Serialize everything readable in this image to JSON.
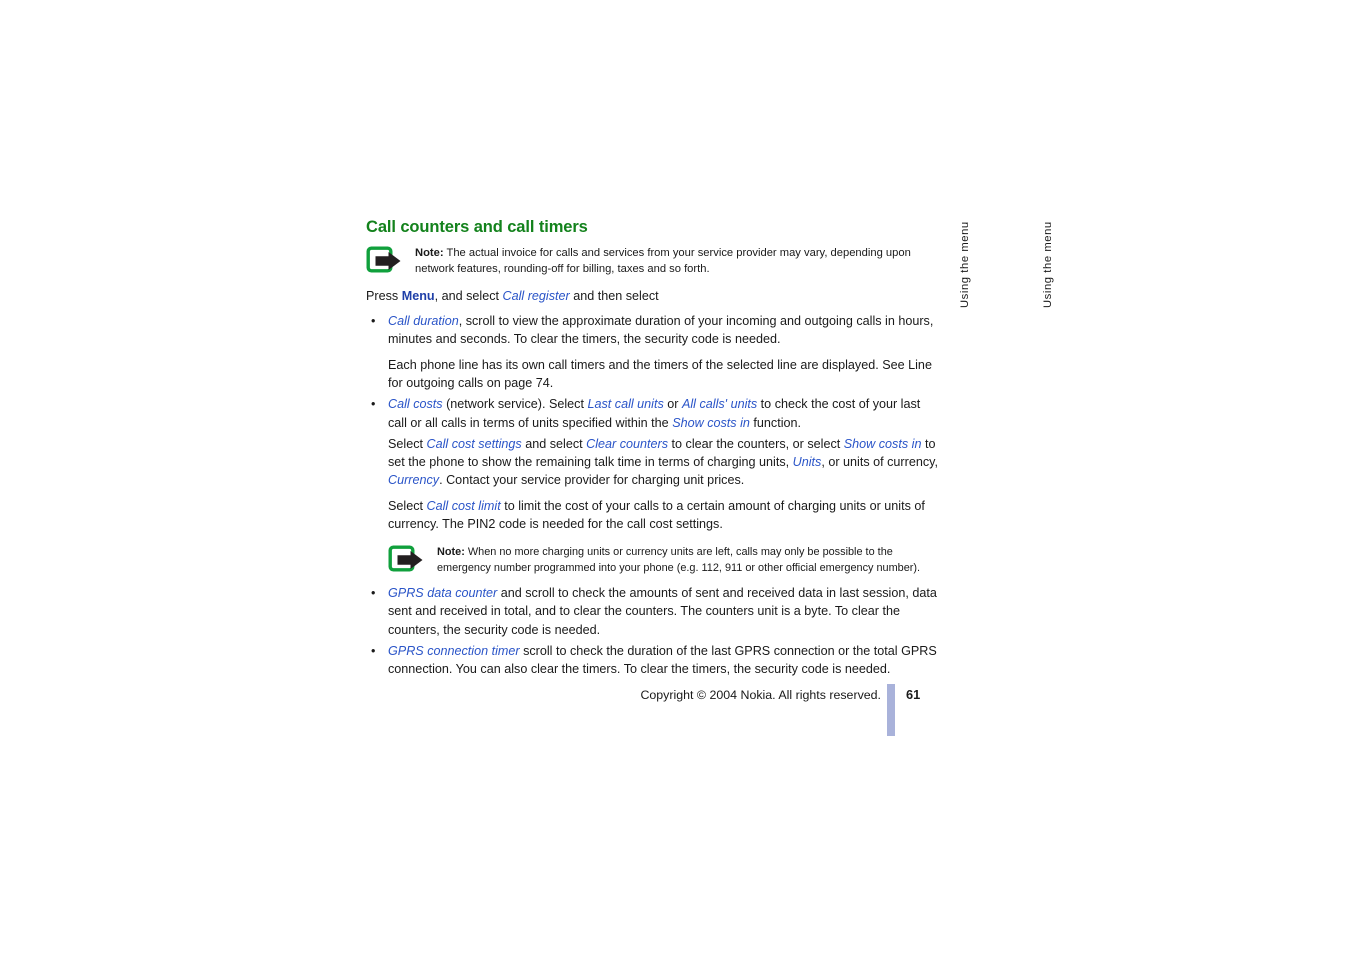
{
  "document": {
    "heading": "Call counters and call timers",
    "notes": {
      "note_label": "Note:",
      "first": "The actual invoice for calls and services from your service provider may vary, depending upon network features, rounding-off for billing, taxes and so forth.",
      "second": "When no more charging units or currency units are left, calls may only be possible to the emergency number programmed into your phone (e.g. 112, 911 or other official emergency number)."
    },
    "intro": {
      "press": "Press ",
      "menu_word": "Menu",
      "and_select": ", and select ",
      "call_register": "Call register",
      "then_select": " and then select"
    },
    "bullets": [
      {
        "term": "Call duration",
        "text": ", scroll to view the approximate duration of your incoming and outgoing calls in hours, minutes and seconds. To clear the timers, the security code is needed.",
        "sub": "Each phone line has its own call timers and the timers of the selected line are displayed. See Line for outgoing calls on page 74."
      },
      {
        "term": "Call costs",
        "text_a": " (network service). Select ",
        "term_b": "Last call units",
        "text_b": " or ",
        "term_c": "All calls' units",
        "text_c": " to check the cost of your last call or all calls in terms of units specified within the ",
        "term_d": "Show costs in",
        "text_d": " function."
      },
      {
        "term": "GPRS data counter",
        "text": " and scroll to check the amounts of sent and received data in last session, data sent and received in total, and to clear the counters. The counters unit is a byte. To clear the counters, the security code is needed."
      },
      {
        "term": "GPRS connection timer",
        "text": " scroll to check the duration of the last GPRS connection or the total GPRS connection. You can also clear the timers. To clear the timers, the security code is needed."
      }
    ],
    "cost_settings_para": {
      "select_1": "Select ",
      "term_1": "Call cost settings",
      "mid_1": " and select ",
      "term_2": "Clear counters",
      "mid_2": " to clear the counters, or select ",
      "term_3": "Show costs in",
      "mid_3": " to set the phone to show the remaining talk time in terms of charging units, ",
      "term_4": "Units",
      "mid_4": ", or units of currency, ",
      "term_5": "Currency",
      "mid_5": ". Contact your service provider for charging unit prices."
    },
    "cost_limit_para": {
      "select_1": "Select ",
      "term_1": "Call cost limit",
      "rest": " to limit the cost of your calls to a certain amount of charging units or units of currency. The PIN2 code is needed for the call cost settings."
    },
    "side_tabs": [
      "Using the menu",
      "Using the menu"
    ],
    "footer": {
      "copyright": "Copyright © 2004 Nokia. All rights reserved.",
      "page_number": "61"
    },
    "colors": {
      "heading_green": "#13821c",
      "term_blue": "#2b55c8",
      "ui_word_blue": "#1f3fa8",
      "footer_bar": "#a9b2da",
      "icon_green": "#10a03c",
      "icon_dark": "#231f20"
    }
  }
}
